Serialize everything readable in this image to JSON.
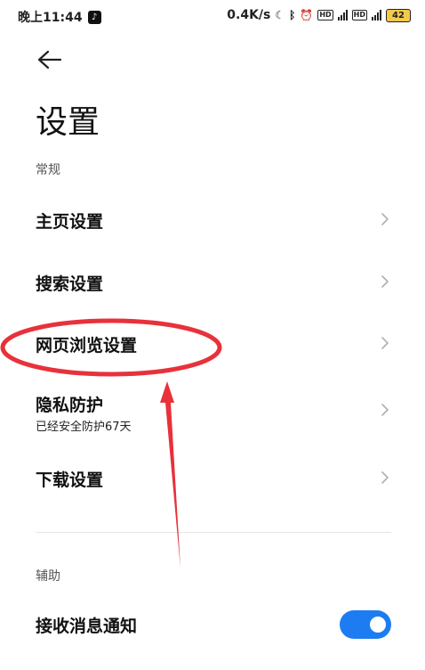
{
  "status_bar": {
    "time": "晚上11:44",
    "app_icon": "tiktok-icon",
    "speed": "0.4K/s",
    "hd1": "HD",
    "hd2": "HD",
    "battery": "42"
  },
  "page": {
    "title": "设置",
    "back_icon": "arrow-left-icon"
  },
  "sections": {
    "general": "常规",
    "assist": "辅助"
  },
  "rows": [
    {
      "label": "主页设置"
    },
    {
      "label": "搜索设置"
    },
    {
      "label": "网页浏览设置"
    },
    {
      "label": "隐私防护",
      "sub": "已经安全防护67天"
    },
    {
      "label": "下载设置"
    }
  ],
  "notification": {
    "label": "接收消息通知",
    "enabled": true
  },
  "colors": {
    "accent": "#1e7cf2",
    "annotation": "#e8313a"
  }
}
